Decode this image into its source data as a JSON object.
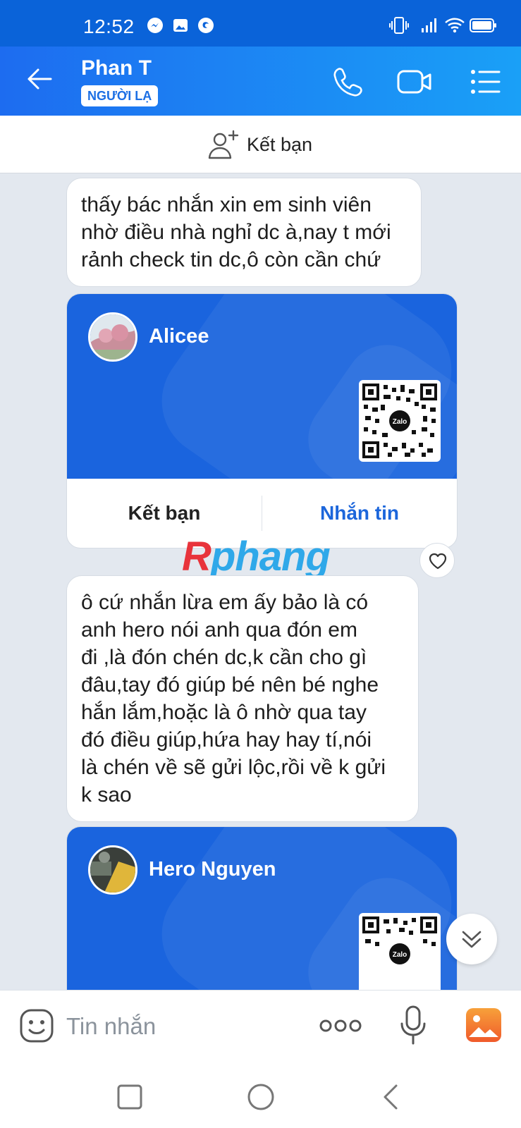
{
  "status": {
    "time": "12:52",
    "icons": [
      "messenger-icon",
      "gallery-icon",
      "app-icon",
      "vibrate-icon",
      "signal-icon",
      "wifi-icon",
      "battery-icon"
    ]
  },
  "header": {
    "contact_name": "Phan T",
    "badge": "NGƯỜI LẠ",
    "icons": [
      "back-arrow-icon",
      "phone-icon",
      "video-call-icon",
      "menu-list-icon"
    ]
  },
  "add_friend_bar": {
    "label": "Kết bạn",
    "icon": "add-person-icon"
  },
  "messages": [
    {
      "type": "text",
      "lines": [
        "thấy bác nhắn xin em sinh viên",
        "nhờ điều nhà nghỉ dc à,nay t mới",
        "rảnh check tin dc,ô còn cần chứ"
      ]
    },
    {
      "type": "contact_card",
      "name": "Alicee",
      "qr_logo": "Zalo",
      "action_left": "Kết bạn",
      "action_right": "Nhắn tin"
    },
    {
      "type": "text",
      "lines": [
        "ô cứ nhắn lừa em ấy bảo là có",
        "anh hero nói anh qua đón em",
        "đi ,là đón chén dc,k cần cho gì",
        "đâu,tay đó giúp bé nên bé nghe",
        "hắn lắm,hoặc là ô nhờ qua tay",
        "đó điều giúp,hứa hay hay tí,nói",
        "là chén về sẽ gửi lộc,rồi về k gửi",
        "k sao"
      ]
    },
    {
      "type": "contact_card",
      "name": "Hero Nguyen",
      "qr_logo": "Zalo"
    }
  ],
  "watermark": {
    "first": "R",
    "rest": "phang"
  },
  "input": {
    "placeholder": "Tin nhắn",
    "icons": [
      "emoji-icon",
      "more-options-icon",
      "microphone-icon",
      "image-icon"
    ]
  },
  "colors": {
    "header_start": "#1d6cf0",
    "header_end": "#1aa0f7",
    "card_bg": "#1a64de",
    "accent": "#1c66db",
    "chat_bg": "#e3e8ef"
  }
}
